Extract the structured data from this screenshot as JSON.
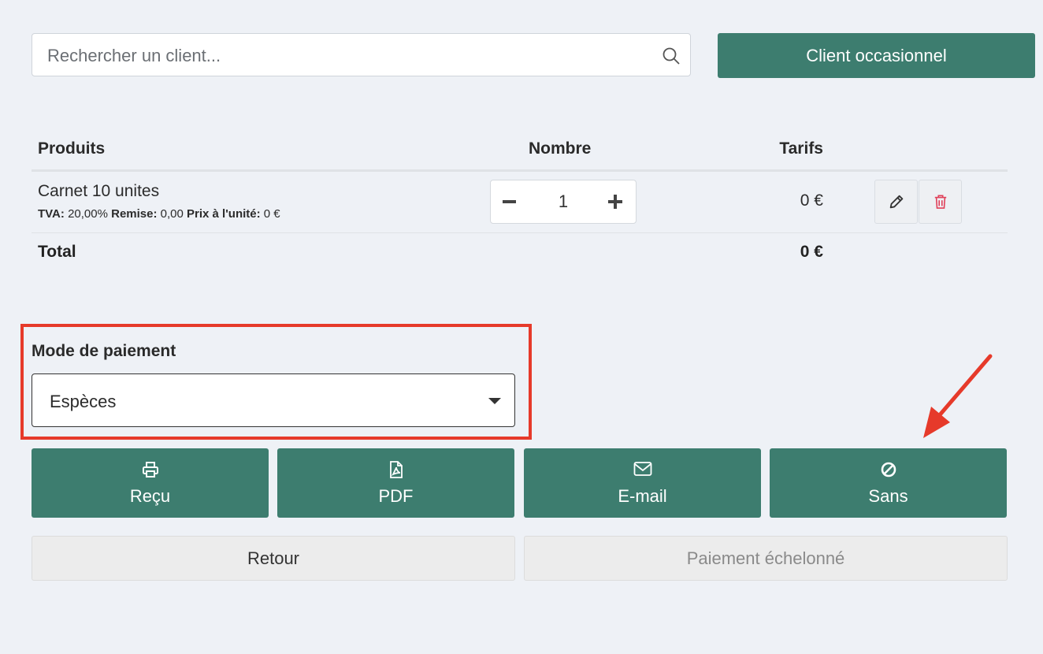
{
  "search": {
    "placeholder": "Rechercher un client...",
    "icon": "search-icon"
  },
  "client_button": {
    "label": "Client occasionnel"
  },
  "table": {
    "headers": {
      "product": "Produits",
      "quantity": "Nombre",
      "price": "Tarifs"
    },
    "rows": [
      {
        "name": "Carnet 10 unites",
        "tva_label": "TVA:",
        "tva_value": "20,00%",
        "remise_label": "Remise:",
        "remise_value": "0,00",
        "unit_label": "Prix à l'unité:",
        "unit_value": "0 €",
        "quantity": "1",
        "price": "0 €"
      }
    ],
    "total_label": "Total",
    "total_value": "0 €"
  },
  "payment": {
    "label": "Mode de paiement",
    "selected": "Espèces"
  },
  "actions": [
    {
      "label": "Reçu",
      "icon": "printer-icon"
    },
    {
      "label": "PDF",
      "icon": "pdf-file-icon"
    },
    {
      "label": "E-mail",
      "icon": "envelope-icon"
    },
    {
      "label": "Sans",
      "icon": "ban-icon"
    }
  ],
  "footer": {
    "back_label": "Retour",
    "installment_label": "Paiement échelonné"
  },
  "colors": {
    "primary": "#3d7d6f",
    "annotation": "#e63a2a",
    "danger": "#e0415a",
    "background": "#eef1f6"
  }
}
